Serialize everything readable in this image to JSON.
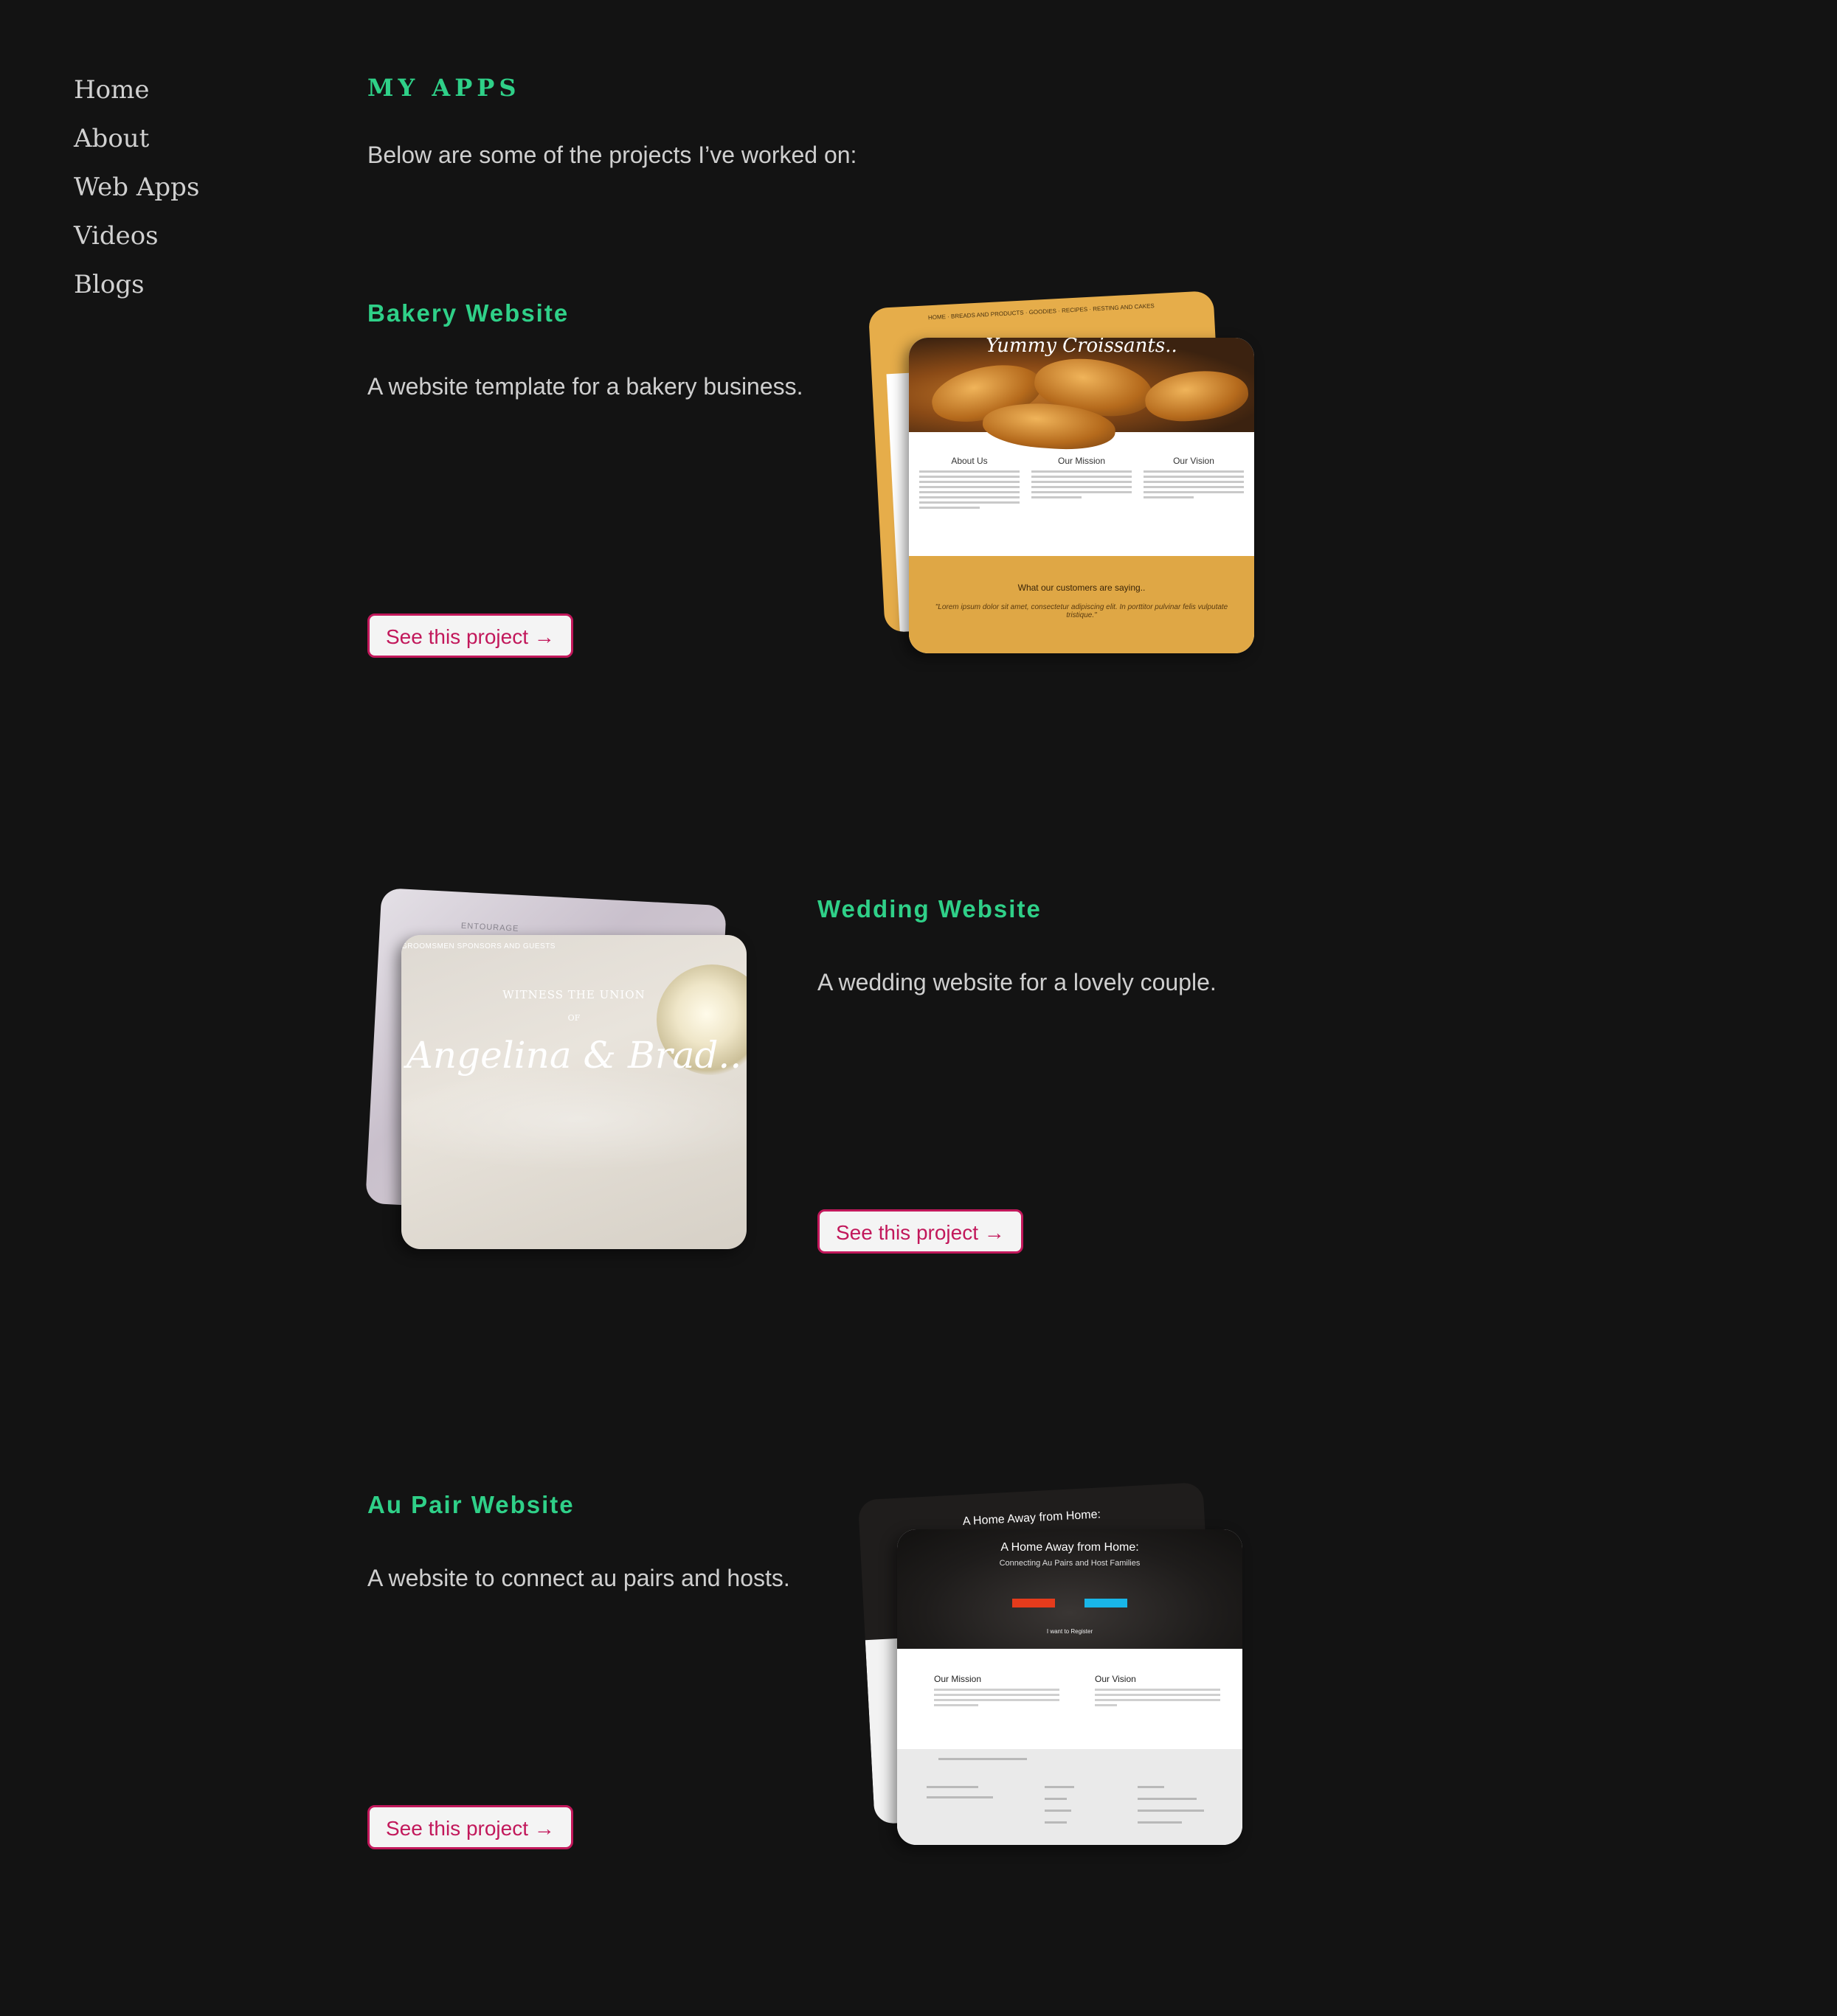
{
  "nav": {
    "items": [
      "Home",
      "About",
      "Web Apps",
      "Videos",
      "Blogs"
    ]
  },
  "page": {
    "title": "MY APPS",
    "intro": "Below are some of the projects I’ve worked on:"
  },
  "projects": [
    {
      "title": "Bakery Website",
      "description": "A website template for a bakery business.",
      "button_label": "See this project →",
      "preview": {
        "hero_title": "Yummy Croissants..",
        "columns": [
          "About Us",
          "Our Mission",
          "Our Vision"
        ],
        "testimonial_heading": "What our customers are saying..",
        "testimonial_quote": "\"Lorem ipsum dolor sit amet, consectetur adipiscing elit. In porttitor pulvinar felis vulputate tristique.\""
      }
    },
    {
      "title": "Wedding Website",
      "description": "A wedding website for a lovely couple.",
      "button_label": "See this project →",
      "preview": {
        "menu": "GROOMSMEN    SPONSORS AND GUESTS",
        "back_menu": "ENTOURAGE",
        "witness": "WITNESS THE UNION",
        "of": "OF",
        "names": "Angelina & Brad.."
      }
    },
    {
      "title": "Au Pair Website",
      "description": "A website to connect au pairs and hosts.",
      "button_label": "See this project →",
      "preview": {
        "hero_title": "A Home Away from Home:",
        "hero_subtitle": "Connecting Au Pairs and Host Families",
        "register": "I want to Register",
        "columns": [
          "Our Mission",
          "Our Vision"
        ]
      }
    }
  ],
  "colors": {
    "background": "#131313",
    "accent_green": "#2fd088",
    "button_border": "#c2185b",
    "text": "#cfcfcf"
  }
}
